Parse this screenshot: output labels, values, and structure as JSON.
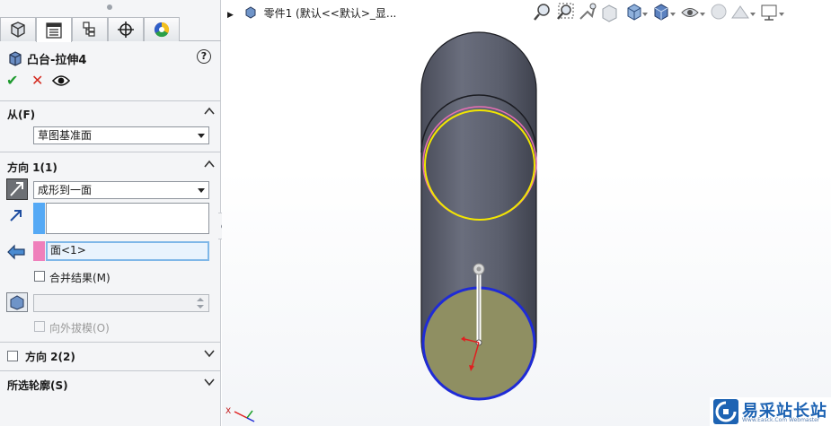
{
  "property_manager": {
    "tabs": [
      {
        "name": "feature-manager-tab",
        "icon": "feature-tree-icon"
      },
      {
        "name": "property-manager-tab",
        "icon": "property-list-icon"
      },
      {
        "name": "configuration-manager-tab",
        "icon": "configuration-icon"
      },
      {
        "name": "dimxpert-manager-tab",
        "icon": "crosshair-icon"
      },
      {
        "name": "display-manager-tab",
        "icon": "color-wheel-icon"
      }
    ],
    "feature_title": "凸台-拉伸4",
    "help_glyph": "?",
    "actions": {
      "ok": "✔",
      "cancel": "✕",
      "preview_icon": "eye-icon"
    },
    "from_section": {
      "title": "从(F)",
      "start_condition": "草图基准面"
    },
    "direction1_section": {
      "title": "方向 1(1)",
      "end_condition": "成形到一面",
      "direction_value": "",
      "face_value": "面<1>",
      "merge_label": "合并结果(M)",
      "merge_checked": false,
      "draft_value": "",
      "draft_outward_label": "向外拔模(O)",
      "draft_outward_checked": false
    },
    "direction2_section": {
      "title": "方向 2(2)",
      "checked": false
    },
    "selected_contours_section": {
      "title": "所选轮廓(S)"
    }
  },
  "viewport": {
    "tree_label": "零件1  (默认<<默认>_显...",
    "triad_x_label": "X",
    "watermark": {
      "text": "易采站长站",
      "sub": "Www.Easck.Com  Webmaster"
    },
    "hud_icons": [
      "zoom-to-fit-icon",
      "zoom-area-icon",
      "previous-view-icon",
      "section-view-icon",
      "view-orientation-icon",
      "display-style-icon",
      "hide-show-icon",
      "edit-appearance-icon",
      "apply-scene-icon",
      "view-settings-icon",
      "monitor-icon"
    ]
  },
  "colors": {
    "body_gray": "#5d6170",
    "sketch_yellow": "#f2e600",
    "sketch_pink": "#e76fb4",
    "end_face_blue": "#1f2bd6",
    "end_face_fill": "#8f8f62",
    "selection_pink": "#ef7fbb",
    "selection_blue": "#55a9f5"
  }
}
